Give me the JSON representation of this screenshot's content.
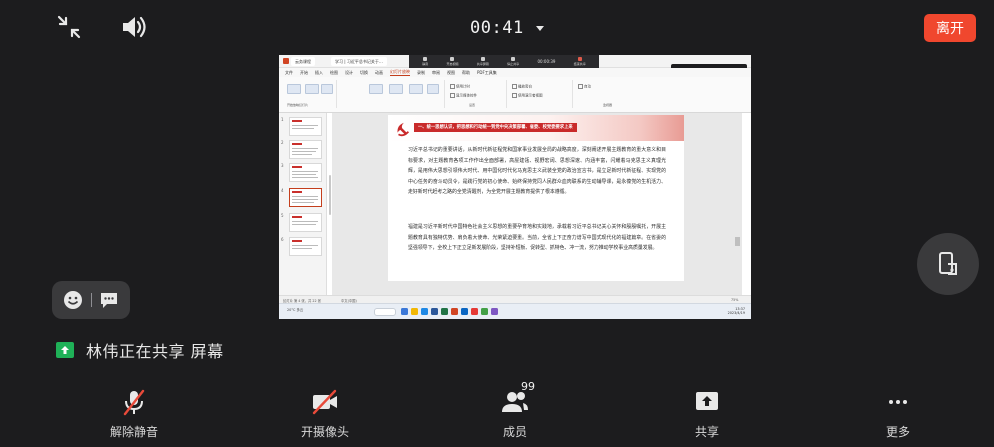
{
  "top_bar": {
    "timer": "00:41",
    "leave_label": "离开"
  },
  "shared_screen": {
    "titlebar": {
      "tabs": [
        "云务课程",
        "学习 | 习近平总书记关于…"
      ]
    },
    "meeting_toolbar": {
      "items": [
        "静音",
        "开启视频",
        "共享屏幕",
        "停止共享",
        "结束共享"
      ],
      "timer": "00:00:39"
    },
    "menu": {
      "items": [
        "文件",
        "开始",
        "插入",
        "绘图",
        "设计",
        "切换",
        "动画",
        "幻灯片放映",
        "录制",
        "审阅",
        "视图",
        "帮助",
        "PDF工具集"
      ],
      "active_index": 7
    },
    "ribbon": {
      "group_labels": [
        "开始放映幻灯片",
        "设置",
        "监视器"
      ],
      "checks": [
        "使用计时",
        "显示媒体控件",
        "播放旁白",
        "使用演示者视图"
      ],
      "monitor_label": "自动"
    },
    "video_tile_label": "林伟",
    "thumbnail_numbers": [
      "1",
      "2",
      "3",
      "4",
      "5",
      "6"
    ],
    "slide": {
      "heading": "一、统一思想认识，把思想和行动统一到党中央决策部署、省委、校党委要求上来",
      "para1": "习近平总书记的重要讲话，从新时代新征程党和国家事业发展全局的战略高度，深刻阐述开展主题教育的重大意义和目标要求，对主题教育各项工作作出全面部署，高屋建瓴、视野宏阔、思想深邃、内涵丰富，闪耀着马克思主义真理光辉，是用伟大思想引领伟大时代、用中国化时代化马克思主义武装全党的政治宣言书，是立足新时代新征程、实现党的中心任务的奋斗动员令，是践行党的初心使命、始终保持党同人民群众血肉联系的生动辅导课，是永葆党的生机活力、走好新时代赶考之路的全党清醒剂，为全党开展主题教育提供了根本遵循。",
      "para2": "福建是习近平新时代中国特色社会主义思想的重要孕育地和实践地，承载着习近平总书记关心关怀和殷殷嘱托，开展主题教育具有独特优势、肩负着大使命、光荣紧迫要重。当前，全省上下正奋力谱写中国式现代化的福建篇章。在省委的坚强领导下，全校上下正立足新发展阶段，坚持补短板、促转型、抓特色、冲一流，努力推动学校事业高质量发展。"
    },
    "statusbar": {
      "left": "幻灯片 第 4 张，共 22 张",
      "lang": "中文(中国)",
      "zoom": "75%"
    },
    "taskbar": {
      "weather": "20°C 多云",
      "time": "13:37",
      "date": "2023/4/19"
    }
  },
  "share_status": {
    "text": "林伟正在共享 屏幕"
  },
  "bottom_bar": {
    "unmute_label": "解除静音",
    "camera_label": "开摄像头",
    "members_label": "成员",
    "members_count": "99",
    "share_label": "共享",
    "more_label": "更多"
  },
  "colors": {
    "leave_button": "#f0472e",
    "share_indicator": "#1fb158",
    "muted_slash": "#e84a3a",
    "background": "#1c1c1e"
  }
}
